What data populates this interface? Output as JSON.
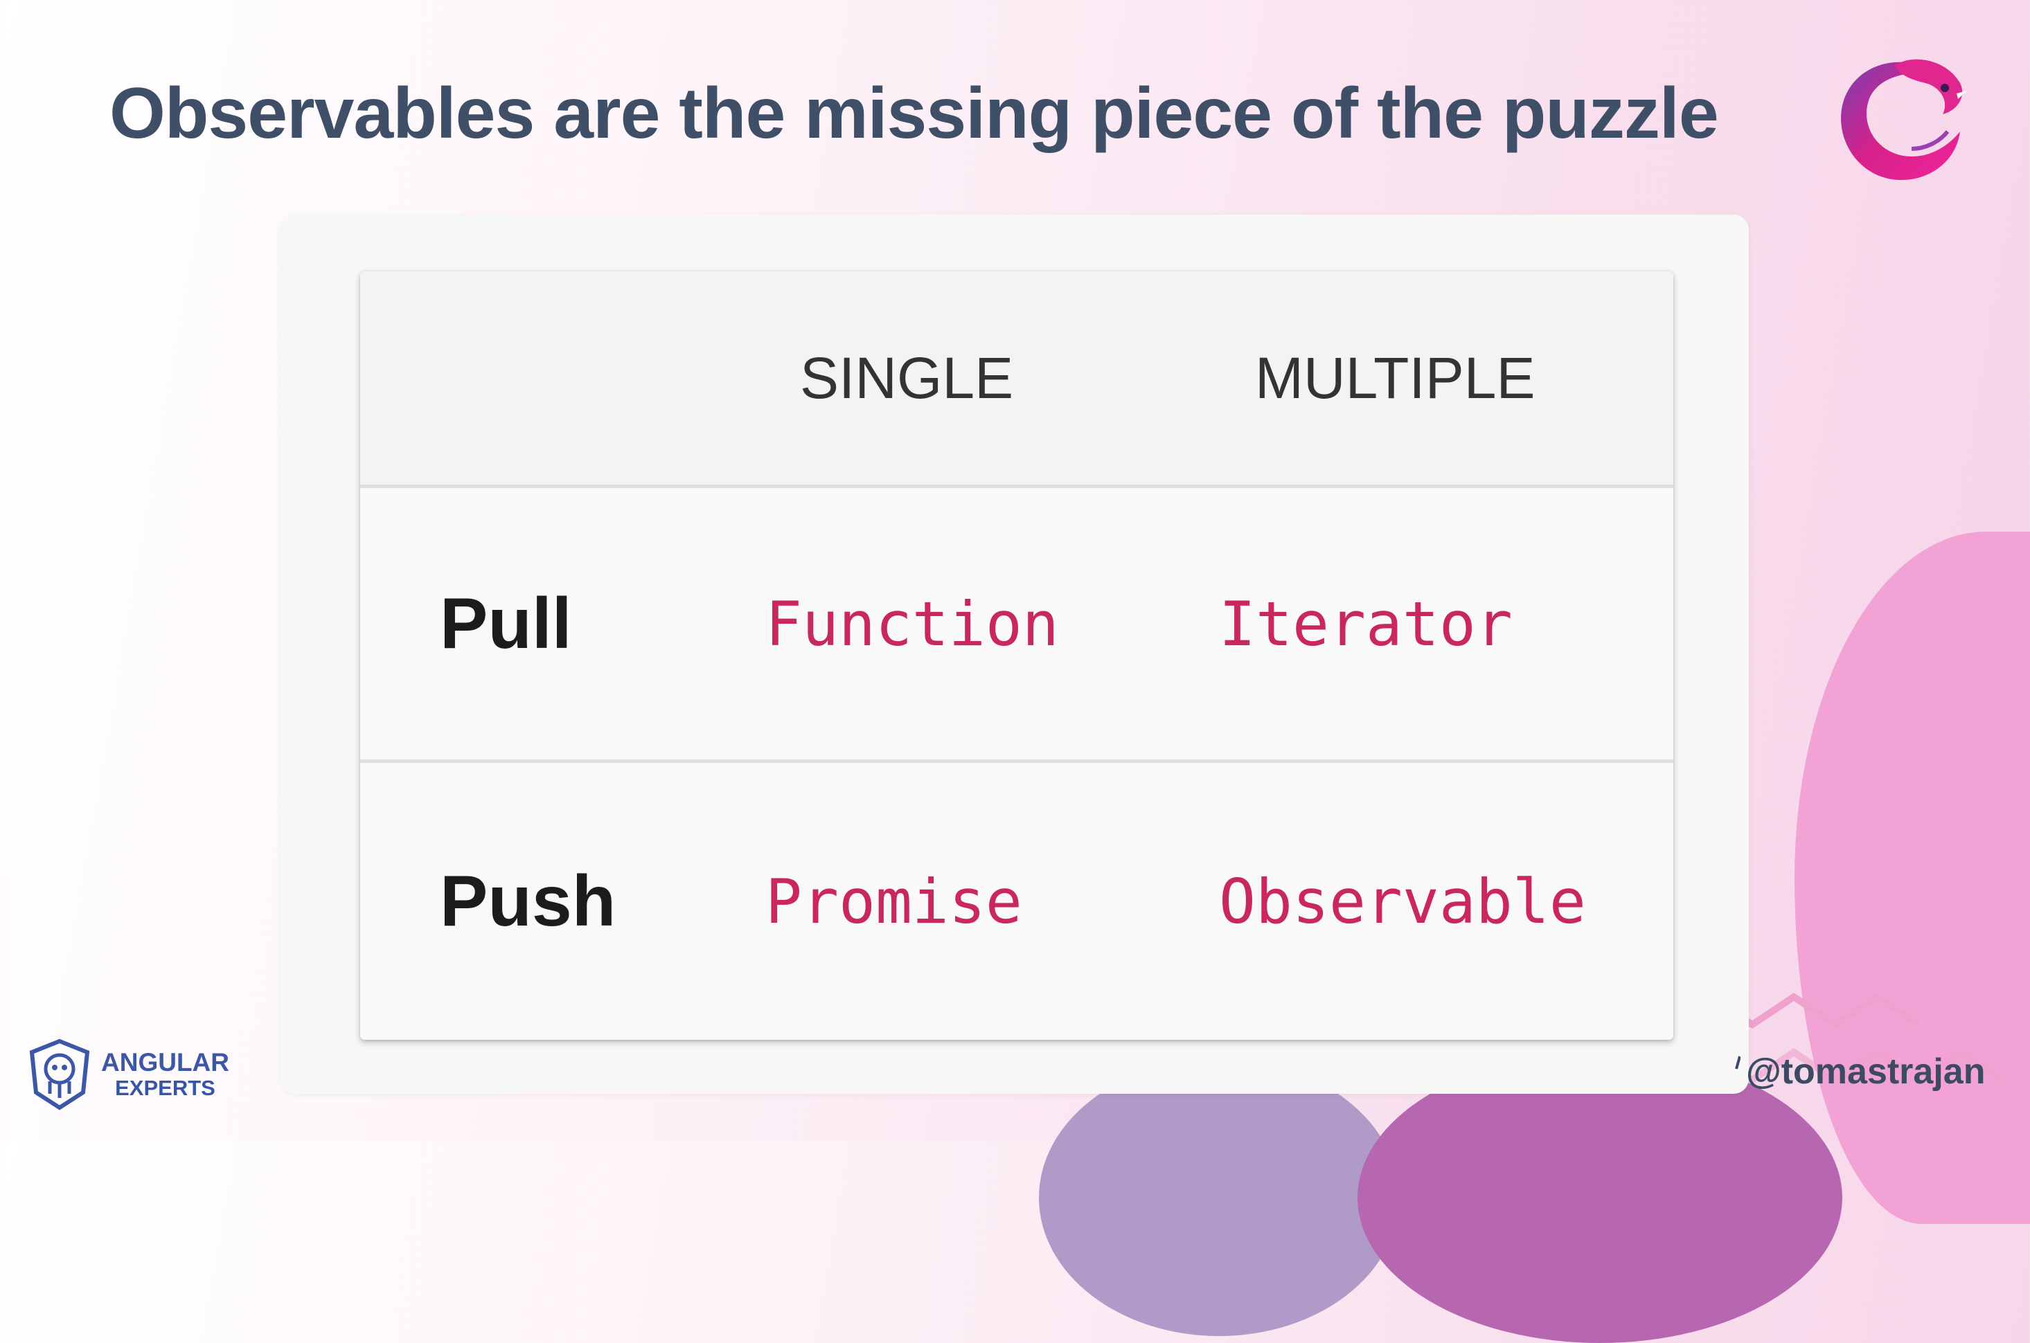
{
  "slide": {
    "title": "Observables are the missing piece of the puzzle",
    "accent_color": "#c9285c",
    "title_color": "#3f4f68"
  },
  "table": {
    "columns": [
      "",
      "SINGLE",
      "MULTIPLE"
    ],
    "rows": [
      {
        "label": "Pull",
        "single": "Function",
        "multiple": "Iterator"
      },
      {
        "label": "Push",
        "single": "Promise",
        "multiple": "Observable"
      }
    ]
  },
  "logos": {
    "rxjs_icon": "rxjs-eel-logo",
    "brand_icon": "angular-experts-shield-icon"
  },
  "footer": {
    "brand_line1": "ANGULAR",
    "brand_line2": "EXPERTS",
    "handle": "@tomastrajan"
  }
}
